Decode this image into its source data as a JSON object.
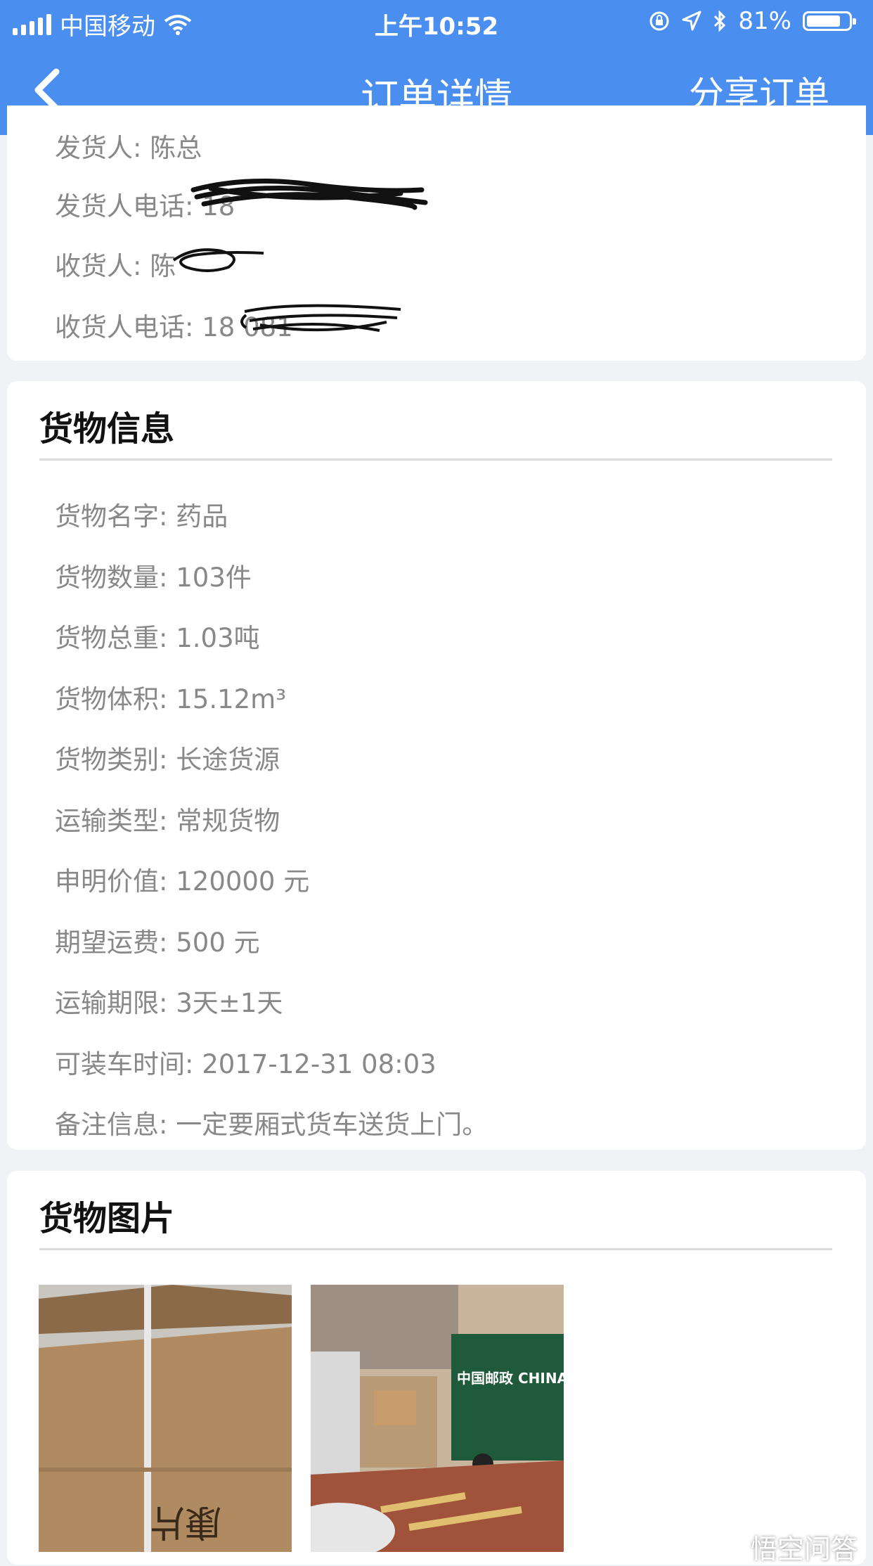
{
  "status_bar": {
    "carrier": "中国移动",
    "time": "上午10:52",
    "battery_text": "81%",
    "battery_level": 0.81
  },
  "nav": {
    "title": "订单详情",
    "share_label": "分享订单"
  },
  "contact": {
    "shipper_label": "发货人:",
    "shipper_value": "陈总",
    "shipper_phone_label": "发货人电话:",
    "shipper_phone_value": "18",
    "receiver_label": "收货人:",
    "receiver_value": "陈",
    "receiver_phone_label": "收货人电话:",
    "receiver_phone_value": "18          081"
  },
  "cargo_info": {
    "title": "货物信息",
    "rows": [
      {
        "label": "货物名字:",
        "value": "药品"
      },
      {
        "label": "货物数量:",
        "value": "103件"
      },
      {
        "label": "货物总重:",
        "value": "1.03吨"
      },
      {
        "label": "货物体积:",
        "value": "15.12m³"
      },
      {
        "label": "货物类别:",
        "value": "长途货源"
      },
      {
        "label": "运输类型:",
        "value": "常规货物"
      },
      {
        "label": "申明价值:",
        "value": "120000 元"
      },
      {
        "label": "期望运费:",
        "value": "500 元"
      },
      {
        "label": "运输期限:",
        "value": "3天±1天"
      },
      {
        "label": "可装车时间:",
        "value": "2017-12-31 08:03"
      },
      {
        "label": "备注信息:",
        "value": "一定要厢式货车送货上门。"
      }
    ]
  },
  "cargo_photos": {
    "title": "货物图片",
    "photo1_text": "康片",
    "photo2_text": "中国邮政 CHINA POST"
  },
  "watermark": "悟空问答",
  "colors": {
    "accent": "#4a8ff0",
    "text_gray": "#888888",
    "background": "#f1f2f6"
  }
}
